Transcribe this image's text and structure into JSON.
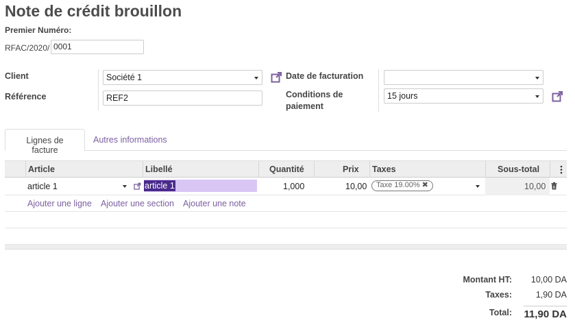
{
  "page": {
    "title": "Note de crédit brouillon"
  },
  "numbering": {
    "label": "Premier Numéro:",
    "prefix": "RFAC/2020/",
    "value": "0001"
  },
  "form": {
    "client_label": "Client",
    "client_value": "Société 1",
    "reference_label": "Référence",
    "reference_value": "REF2",
    "invoice_date_label": "Date de facturation",
    "invoice_date_value": "",
    "payment_terms_label_1": "Conditions de",
    "payment_terms_label_2": "paiement",
    "payment_terms_value": "15 jours"
  },
  "tabs": [
    {
      "label": "Lignes de facture",
      "active": true
    },
    {
      "label": "Autres informations",
      "active": false
    }
  ],
  "grid": {
    "columns": [
      "Article",
      "Libellé",
      "Quantité",
      "Prix",
      "Taxes",
      "Sous-total"
    ],
    "rows": [
      {
        "article": "article 1",
        "libelle": "article 1",
        "quantite": "1,000",
        "prix": "10,00",
        "taxe": "Taxe 19.00%",
        "sous_total": "10,00"
      }
    ],
    "add_links": [
      "Ajouter une ligne",
      "Ajouter une section",
      "Ajouter une note"
    ]
  },
  "totals": {
    "ht_label": "Montant HT:",
    "ht_value": "10,00 DA",
    "taxes_label": "Taxes:",
    "taxes_value": "1,90 DA",
    "total_label": "Total:",
    "total_value": "11,90 DA"
  },
  "colors": {
    "accent": "#7c5fa0",
    "selection": "#4a2a8c",
    "edit_highlight": "#d9c6f5"
  },
  "icons": {
    "external_link": "external-link-icon",
    "trash": "trash-icon",
    "options": "kebab-icon"
  }
}
